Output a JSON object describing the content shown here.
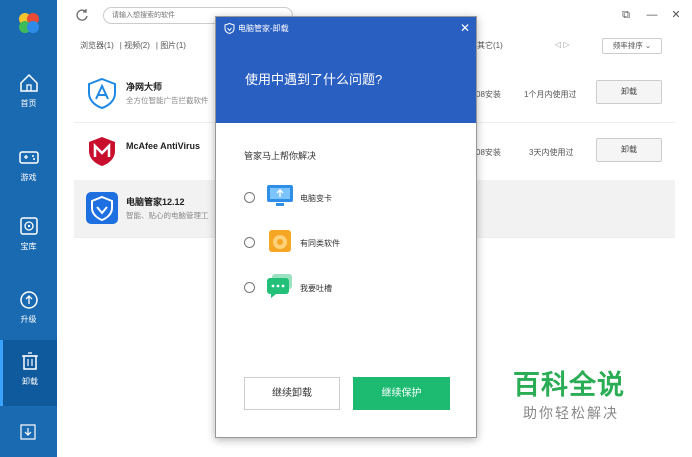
{
  "search": {
    "placeholder": "请输入想搜索的软件"
  },
  "sidebar": {
    "items": [
      {
        "label": "首页"
      },
      {
        "label": "游戏"
      },
      {
        "label": "宝库"
      },
      {
        "label": "升级"
      },
      {
        "label": "卸载"
      }
    ]
  },
  "filters": [
    "浏览器(1)",
    "视频(2)",
    "图片(1)",
    "其它(1)"
  ],
  "sort_label": "频率排序 ⌄",
  "apps": [
    {
      "name": "净网大师",
      "desc": "全方位智能广告拦截软件",
      "installed": "08安装",
      "usage": "1个月内使用过",
      "action": "卸载"
    },
    {
      "name": "McAfee AntiVirus",
      "desc": "",
      "installed": "08安装",
      "usage": "3天内使用过",
      "action": "卸载"
    },
    {
      "name": "电脑管家12.12",
      "desc": "智能、贴心的电脑管理工",
      "installed": "",
      "usage": "",
      "action": ""
    }
  ],
  "dialog": {
    "title": "电脑管家-卸载",
    "question": "使用中遇到了什么问题?",
    "subtitle": "管家马上帮你解决",
    "options": [
      {
        "label": "电脑变卡"
      },
      {
        "label": "有同类软件"
      },
      {
        "label": "我要吐槽"
      }
    ],
    "btn_uninstall": "继续卸载",
    "btn_protect": "继续保护"
  },
  "watermark": {
    "big": "百科全说",
    "small": "助你轻松解决"
  },
  "colors": {
    "sidebar": "#1a6ab1",
    "dialog_header": "#2a5fc2",
    "primary_green": "#1dbb72",
    "watermark_green": "#2bad56"
  }
}
